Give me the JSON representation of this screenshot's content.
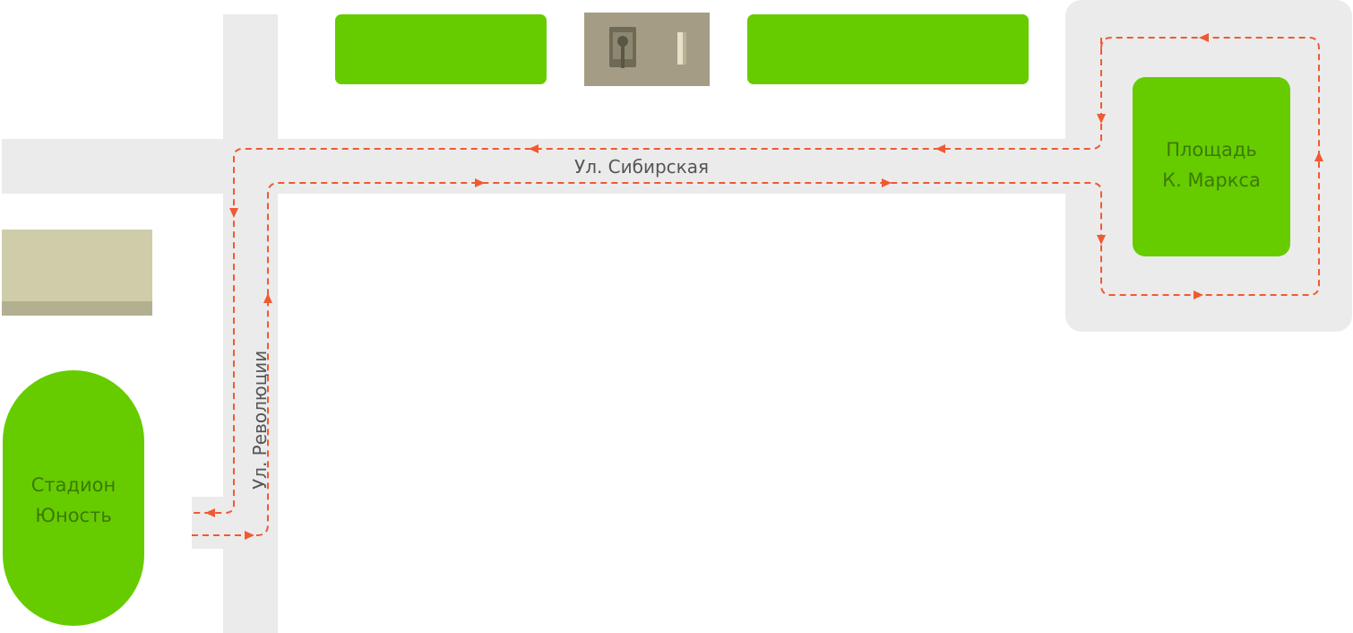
{
  "colors": {
    "background": "#ffffff",
    "road": "#ebebeb",
    "park": "#66cc00",
    "park_text": "#3c7a06",
    "building": "#cfcda9",
    "building_shadow": "#b3b092",
    "monument": "#a59c85",
    "route": "#f05a32",
    "street_text": "#555555"
  },
  "streets": {
    "sibirskaya": "Ул. Сибирская",
    "revolyutsii": "Ул. Революции"
  },
  "places": {
    "square_line1": "Площадь",
    "square_line2": "К. Маркса",
    "stadium_line1": "Стадион",
    "stadium_line2": "Юность"
  },
  "icons": {
    "monument": "tank-monument-icon",
    "arrow": "route-arrow-icon"
  }
}
